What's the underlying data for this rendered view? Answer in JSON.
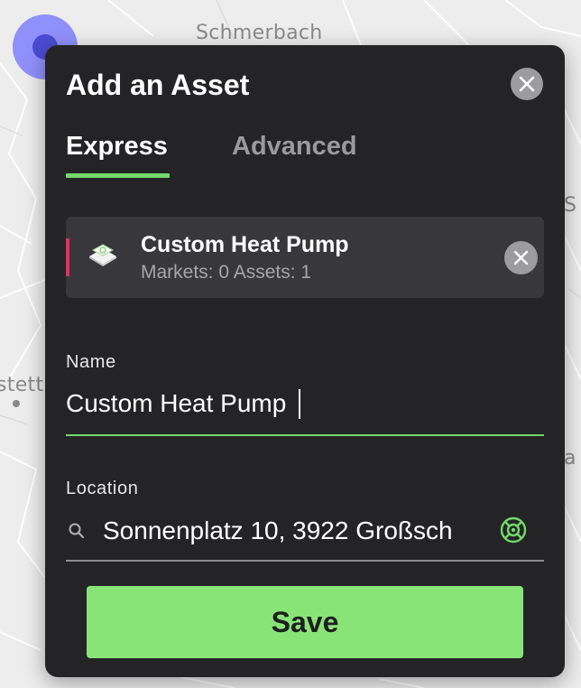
{
  "map": {
    "labels": {
      "town_top": "Schmerbach",
      "town_left_fragment": "stett",
      "right_fragment_1": "S",
      "right_fragment_2": "a"
    }
  },
  "dialog": {
    "title": "Add an Asset",
    "close_icon": "close-icon"
  },
  "tabs": [
    {
      "label": "Express",
      "active": true
    },
    {
      "label": "Advanced",
      "active": false
    }
  ],
  "asset_card": {
    "name": "Custom Heat Pump",
    "markets_label": "Markets: 0",
    "assets_label": "Assets: 1",
    "icon": "heat-pump-icon",
    "accent_color": "#e0315d"
  },
  "name_field": {
    "label": "Name",
    "value": "Custom Heat Pump"
  },
  "location_field": {
    "label": "Location",
    "value": "Sonnenplatz 10, 3922 Großsch",
    "search_icon": "search-icon",
    "locate_icon": "locate-icon"
  },
  "save_button": {
    "label": "Save"
  },
  "colors": {
    "accent_green": "#74d86a",
    "button_green": "#88e477",
    "dialog_bg": "#242426",
    "marker": "#7676ff"
  }
}
